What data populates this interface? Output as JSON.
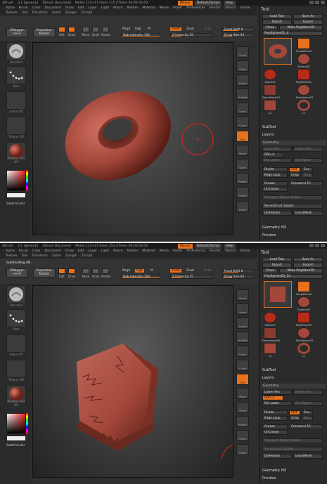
{
  "shot1": {
    "titlebar": {
      "app": "ZBrush",
      "version": "3.1 [general]",
      "doc": "ZBrush Document",
      "stats": "Mems 113+11 Frees 115 ZTimes 00:00:02.00",
      "menus": "Menus",
      "script": "DefaultZScript",
      "help": "Help"
    },
    "menu_row1": [
      "Alpha",
      "Brush",
      "Color",
      "Document",
      "Draw",
      "Edit",
      "Layer",
      "Light",
      "Macro",
      "Marker",
      "Material",
      "Movie",
      "Picker",
      "Preferences",
      "Render",
      "Stencil",
      "Stroke"
    ],
    "menu_row2": [
      "Texture",
      "Tool",
      "Transform",
      "Zoom",
      "Zplugin",
      "Zscript"
    ],
    "zmapper": {
      "line1": "ZMapper",
      "line2": "rev-E"
    },
    "projection_master": {
      "line1": "Projection",
      "line2": "Master"
    },
    "modes": [
      "Edit",
      "Draw",
      "Move",
      "Scale",
      "Rotate"
    ],
    "mrgb": "Mrgb",
    "rgb": "Rgb",
    "m": "M",
    "zadd": "Zadd",
    "zsub": "Zsub",
    "zcut": "Zcut",
    "rgb_intensity": {
      "label": "Rgb Intensity",
      "value": "100"
    },
    "z_intensity": {
      "label": "Z Intensity",
      "value": "25"
    },
    "focal_shift": {
      "label": "Focal Shift",
      "value": "0"
    },
    "draw_size": {
      "label": "Draw Size",
      "value": "64"
    },
    "left_tiles": [
      "Standard",
      "Dots",
      "Alpha Off",
      "Texture Off",
      "RedWax Red Off"
    ],
    "switch_color": "SwitchColor",
    "right_buttons": [
      "Scroll",
      "Zoom",
      "Actual",
      "AAHalf",
      "Local",
      "L.Sym",
      "Xyz",
      "Move",
      "Scale",
      "Rotate",
      "Frame",
      "Lasso"
    ],
    "tray": {
      "title": "Tool",
      "load_tool": "Load Tool",
      "save_as": "Save As",
      "import": "Import",
      "export": "Export",
      "clone": "Clone",
      "make_polymesh": "Make PolyMesh3D",
      "current_tool": "PolySphere01_4",
      "thumbs": [
        "SimpleBrush",
        "Sphere3D",
        "ZSphere",
        "PolyMesh3D",
        "DemoHead#1",
        "PolySphere01",
        "L2",
        "L1"
      ],
      "subtool": "SubTool",
      "layers": "Layers",
      "geometry": "Geometry",
      "lower_res": "Lower Res",
      "higher_res": "Higher Res",
      "sdiv": "SDiv",
      "sdiv_value": "4",
      "del_lower": "Del Lower",
      "del_higher": "Del Higher",
      "divide": "Divide",
      "smt": "Smt",
      "suv": "Suv",
      "edge_loop": "Edge Loop",
      "crisp": "Crisp",
      "disp": "Disp",
      "crease": "Crease",
      "crease_lvl": "CreaseLvl",
      "crease_lvl_value": "15",
      "uncrease": "UnCrease",
      "reproject": "Reproject Higher Subdiv",
      "reconstruct": "Reconstruct Subdiv",
      "del_hidden": "DelHidden",
      "insert_mesh": "InsertMesh",
      "geometry_hd": "Geometry HD",
      "preview": "Preview"
    }
  },
  "shot2": {
    "titlebar": {
      "app": "ZBrush",
      "version": "3.1 [general]",
      "doc": "ZBrush Document",
      "stats": "Mems 113+11 Frees 253 ZTimes 00:00:02.00",
      "menus": "Menus",
      "script": "DefaultZScript",
      "help": "Help"
    },
    "subdividing": "Subdividing (W...",
    "tray": {
      "current_tool": "PolySphere01_54",
      "sdiv_value": "2"
    }
  },
  "colors": {
    "accent": "#e8721c",
    "mesh": "#a3473a",
    "panel": "#2e2e2e"
  }
}
